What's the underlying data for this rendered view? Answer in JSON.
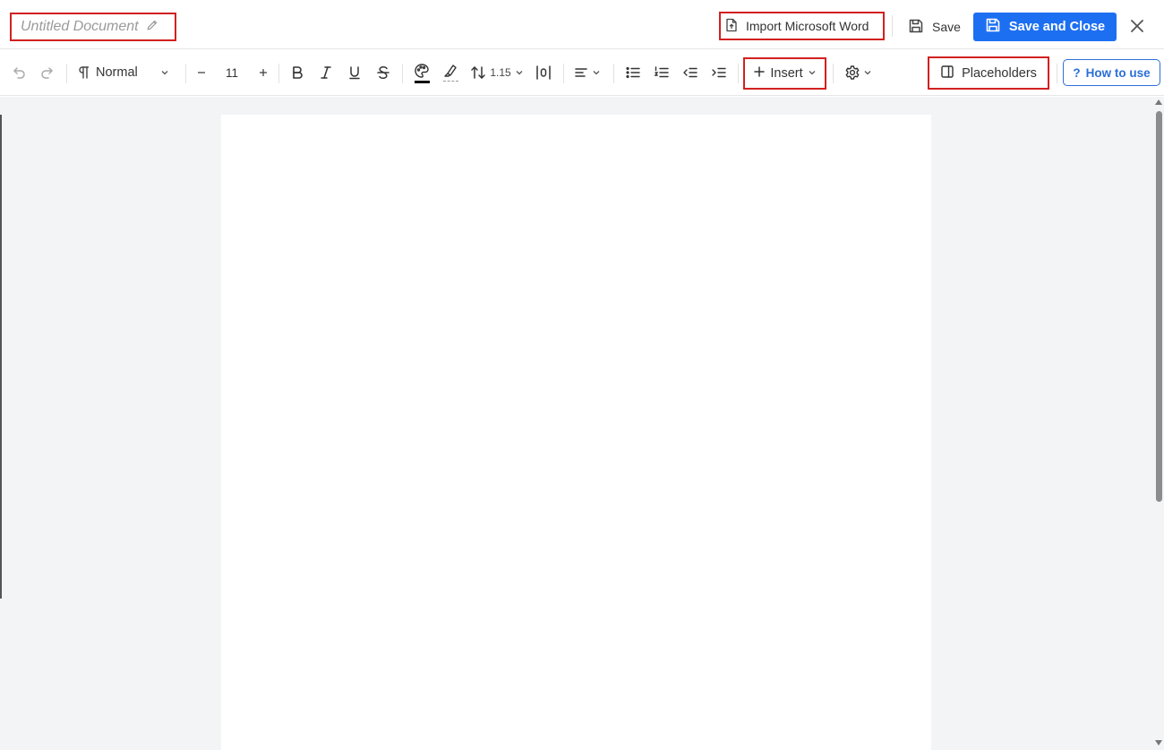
{
  "header": {
    "document_title": "Untitled Document",
    "import_label": "Import Microsoft Word",
    "save_label": "Save",
    "save_close_label": "Save and Close"
  },
  "toolbar": {
    "paragraph_style": "Normal",
    "font_size": "11",
    "line_spacing": "1.15",
    "insert_label": "Insert",
    "placeholders_label": "Placeholders",
    "how_to_use_label": "How to use",
    "how_to_use_icon": "?"
  },
  "icons": {
    "undo": "undo-icon",
    "redo": "redo-icon",
    "paragraph": "paragraph-icon",
    "bold": "bold-icon",
    "italic": "italic-icon",
    "underline": "underline-icon",
    "strikethrough": "strikethrough-icon",
    "text_color": "palette-icon",
    "highlight": "highlighter-icon",
    "line_spacing": "line-spacing-icon",
    "text_direction": "text-direction-icon",
    "align": "align-left-icon",
    "bullet_list": "bullet-list-icon",
    "numbered_list": "numbered-list-icon",
    "outdent": "outdent-icon",
    "indent": "indent-icon",
    "settings": "gear-icon",
    "sidebar": "sidebar-panel-icon"
  },
  "colors": {
    "primary": "#1d6ff2",
    "highlight_box": "#d32020",
    "link_blue": "#2c6fd6",
    "workspace_bg": "#f3f4f6"
  }
}
